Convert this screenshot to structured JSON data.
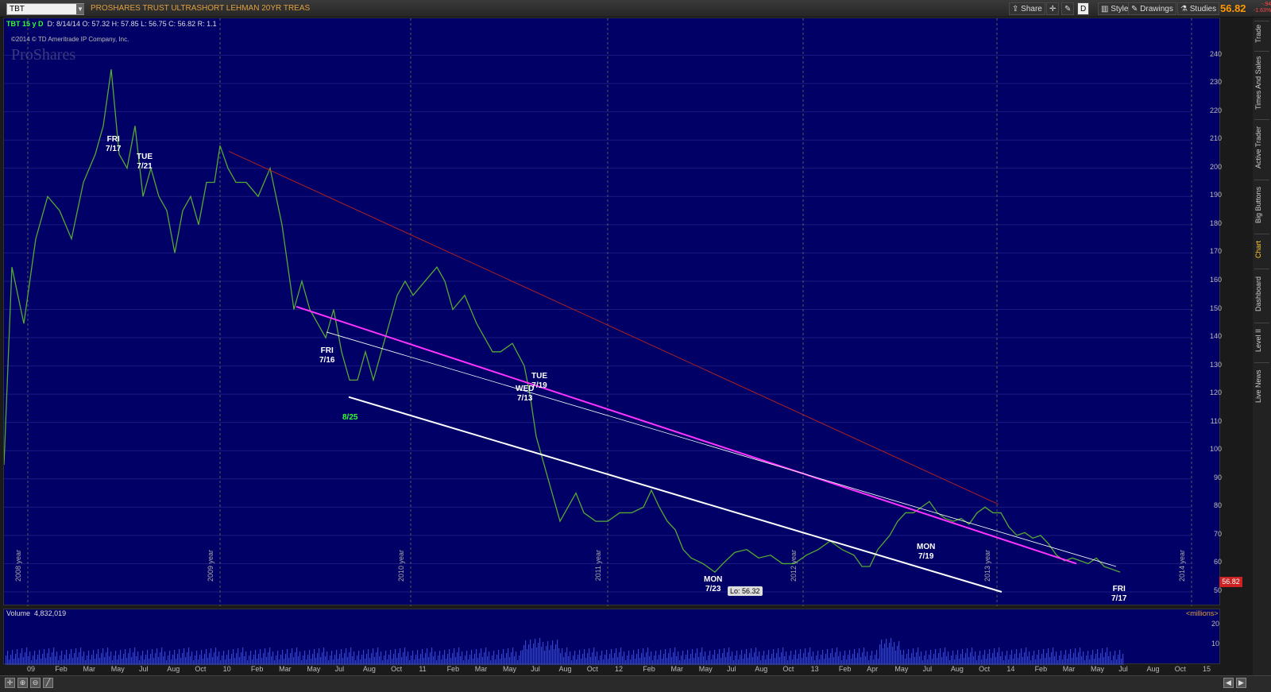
{
  "header": {
    "symbol": "TBT",
    "description": "PROSHARES TRUST ULTRASHORT LEHMAN 20YR TREAS",
    "buttons": [
      "Share",
      "D",
      "Style",
      "Drawings",
      "Studies"
    ],
    "last_price": "56.82",
    "change": "-.94",
    "change_pct": "-1.63%"
  },
  "chart": {
    "info_symbol": "TBT 15 y D",
    "info_values": "D: 8/14/14  O: 57.32  H: 57.85  L: 56.75  C: 56.82  R: 1.1",
    "copyright": "©2014 © TD Ameritrade IP Company, Inc.",
    "watermark": "ProShares",
    "price_label": "56.82",
    "low_tag": "Lo: 56.32",
    "y_ticks": [
      "240",
      "230",
      "220",
      "210",
      "200",
      "190",
      "180",
      "170",
      "160",
      "150",
      "140",
      "130",
      "120",
      "110",
      "100",
      "90",
      "80",
      "70",
      "60",
      "50"
    ],
    "year_labels": [
      "2008 year",
      "2009 year",
      "2010 year",
      "2011 year",
      "2012 year",
      "2013 year",
      "2014 year"
    ],
    "annotations": [
      {
        "day": "FRI",
        "date": "7/17",
        "color": "white"
      },
      {
        "day": "TUE",
        "date": "7/21",
        "color": "white"
      },
      {
        "day": "FRI",
        "date": "7/16",
        "color": "white"
      },
      {
        "day": "",
        "date": "8/25",
        "color": "green"
      },
      {
        "day": "TUE",
        "date": "7/19",
        "color": "white"
      },
      {
        "day": "WED",
        "date": "7/13",
        "color": "white"
      },
      {
        "day": "MON",
        "date": "7/23",
        "color": "white"
      },
      {
        "day": "MON",
        "date": "7/19",
        "color": "white"
      },
      {
        "day": "FRI",
        "date": "7/17",
        "color": "white"
      }
    ]
  },
  "volume": {
    "label": "Volume",
    "value": "4,832,019",
    "unit": "<millions>",
    "ticks": [
      "20",
      "10"
    ]
  },
  "x_axis": [
    "09",
    "Feb",
    "Mar",
    "May",
    "Jul",
    "Aug",
    "Oct",
    "10",
    "Feb",
    "Mar",
    "May",
    "Jul",
    "Aug",
    "Oct",
    "11",
    "Feb",
    "Mar",
    "May",
    "Jul",
    "Aug",
    "Oct",
    "12",
    "Feb",
    "Mar",
    "May",
    "Jul",
    "Aug",
    "Oct",
    "13",
    "Feb",
    "Apr",
    "May",
    "Jul",
    "Aug",
    "Oct",
    "14",
    "Feb",
    "Mar",
    "May",
    "Jul",
    "Aug",
    "Oct",
    "15"
  ],
  "sidebar_tabs": [
    "Trade",
    "Times And Sales",
    "Active Trader",
    "Big Buttons",
    "Chart",
    "Dashboard",
    "Level II",
    "Live News"
  ]
}
